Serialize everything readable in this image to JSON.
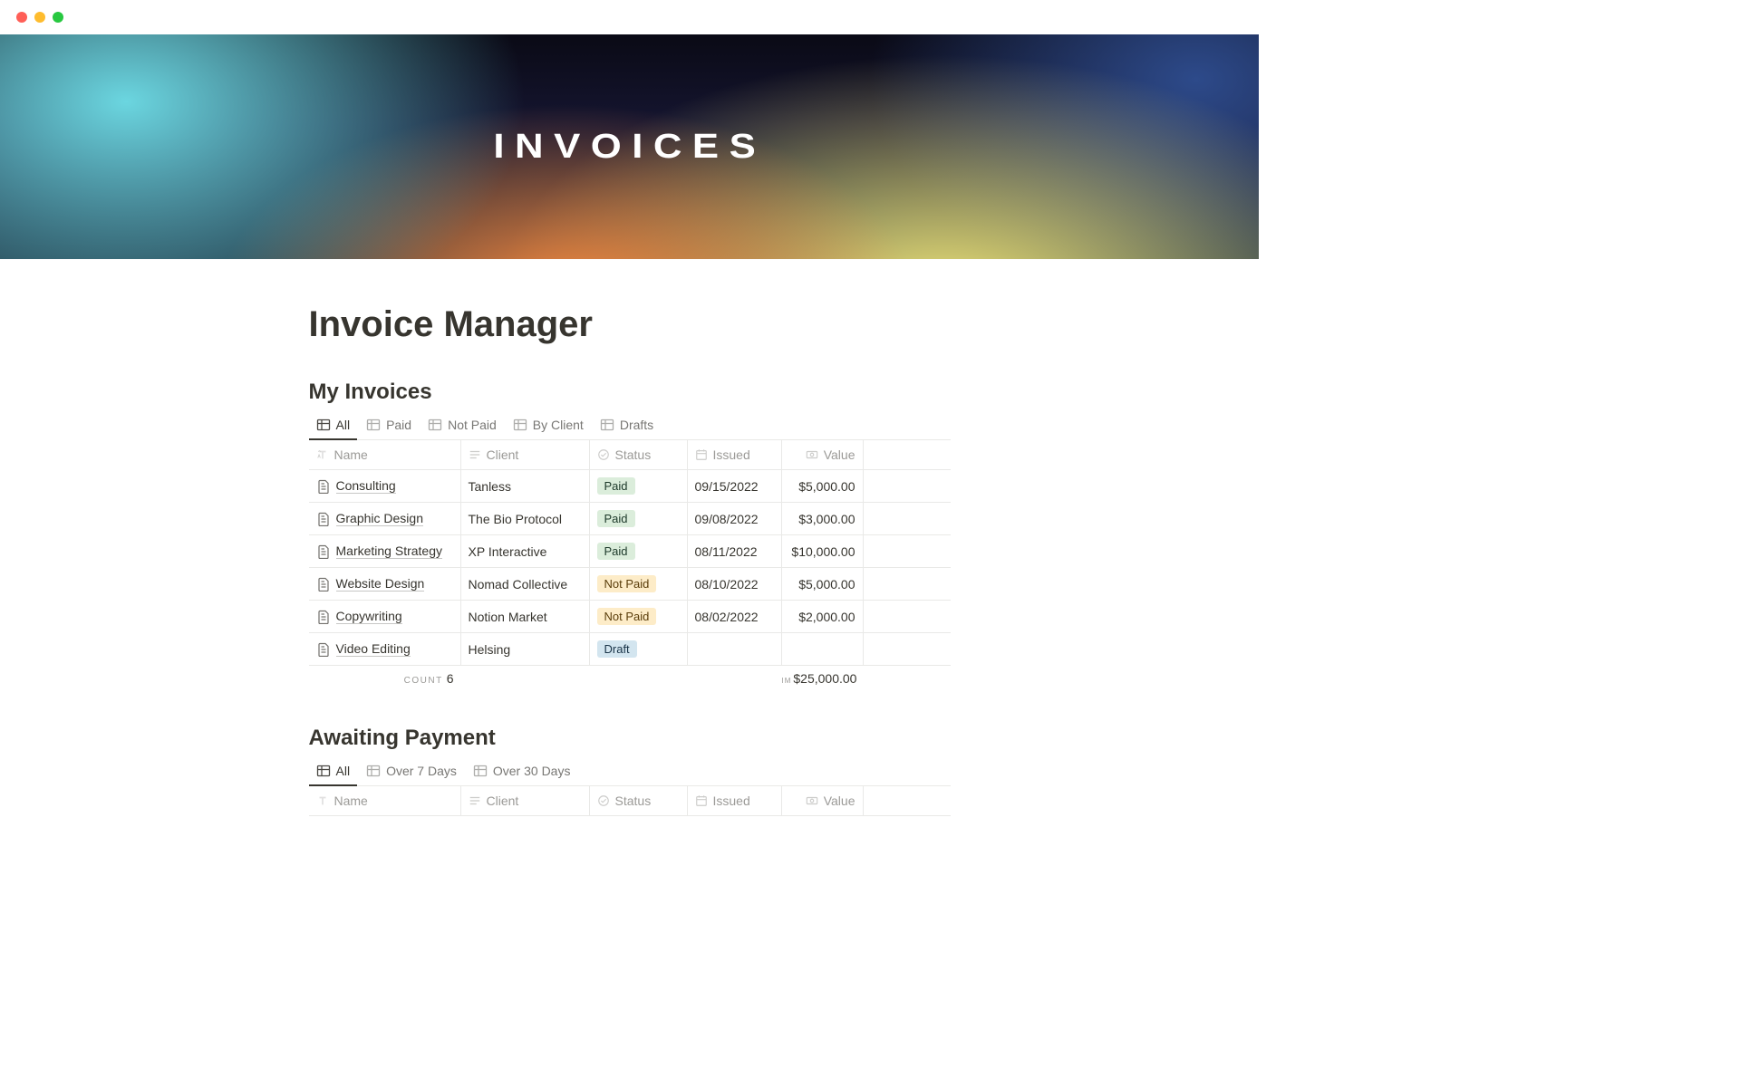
{
  "cover": {
    "title": "INVOICES"
  },
  "page": {
    "title": "Invoice Manager"
  },
  "section1": {
    "title": "My Invoices",
    "tabs": [
      "All",
      "Paid",
      "Not Paid",
      "By Client",
      "Drafts"
    ],
    "columns": {
      "name": "Name",
      "client": "Client",
      "status": "Status",
      "issued": "Issued",
      "value": "Value"
    },
    "rows": [
      {
        "name": "Consulting",
        "client": "Tanless",
        "status": "Paid",
        "statusClass": "paid",
        "issued": "09/15/2022",
        "value": "$5,000.00"
      },
      {
        "name": "Graphic Design",
        "client": "The Bio Protocol",
        "status": "Paid",
        "statusClass": "paid",
        "issued": "09/08/2022",
        "value": "$3,000.00"
      },
      {
        "name": "Marketing Strategy",
        "client": "XP Interactive",
        "status": "Paid",
        "statusClass": "paid",
        "issued": "08/11/2022",
        "value": "$10,000.00"
      },
      {
        "name": "Website Design",
        "client": "Nomad Collective",
        "status": "Not Paid",
        "statusClass": "notpaid",
        "issued": "08/10/2022",
        "value": "$5,000.00"
      },
      {
        "name": "Copywriting",
        "client": "Notion Market",
        "status": "Not Paid",
        "statusClass": "notpaid",
        "issued": "08/02/2022",
        "value": "$2,000.00"
      },
      {
        "name": "Video Editing",
        "client": "Helsing",
        "status": "Draft",
        "statusClass": "draft",
        "issued": "",
        "value": ""
      }
    ],
    "footer": {
      "countLabel": "COUNT",
      "count": "6",
      "sumLabel": "IM",
      "sum": "$25,000.00"
    }
  },
  "section2": {
    "title": "Awaiting Payment",
    "tabs": [
      "All",
      "Over 7 Days",
      "Over 30 Days"
    ],
    "columns": {
      "name": "Name",
      "client": "Client",
      "status": "Status",
      "issued": "Issued",
      "value": "Value"
    }
  }
}
